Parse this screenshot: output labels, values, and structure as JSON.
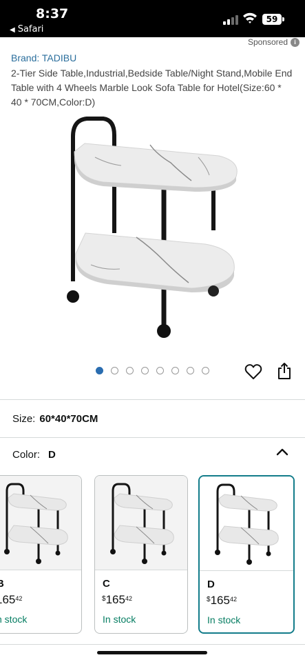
{
  "status_bar": {
    "time": "8:37",
    "back_app": "Safari",
    "battery": "59"
  },
  "ad": {
    "sponsored_label": "Sponsored",
    "info_glyph": "i"
  },
  "product": {
    "brand": "Brand: TADIBU",
    "title": "2-Tier Side Table,Industrial,Bedside Table/Night Stand,Mobile End Table with 4 Wheels Marble Look Sofa Table for Hotel(Size:60 * 40 * 70CM,Color:D)",
    "image_count": 8,
    "active_image": 0
  },
  "size": {
    "label": "Size:",
    "value": "60*40*70CM"
  },
  "color": {
    "label": "Color:",
    "value": "D"
  },
  "swatches": [
    {
      "label": "B",
      "currency": "",
      "price_whole": "165",
      "price_fraction": "42",
      "stock": "n stock"
    },
    {
      "label": "C",
      "currency": "$",
      "price_whole": "165",
      "price_fraction": "42",
      "stock": "In stock"
    },
    {
      "label": "D",
      "currency": "$",
      "price_whole": "165",
      "price_fraction": "42",
      "stock": "In stock"
    }
  ],
  "colors": {
    "brand_link": "#2a6e9c",
    "selected_border": "#127c8a",
    "in_stock": "#067d62",
    "dot_active": "#2a6db0"
  },
  "icons": [
    "back-triangle-icon",
    "signal-icon",
    "wifi-icon",
    "battery-icon",
    "info-icon",
    "heart-icon",
    "share-icon",
    "chevron-up-icon"
  ]
}
